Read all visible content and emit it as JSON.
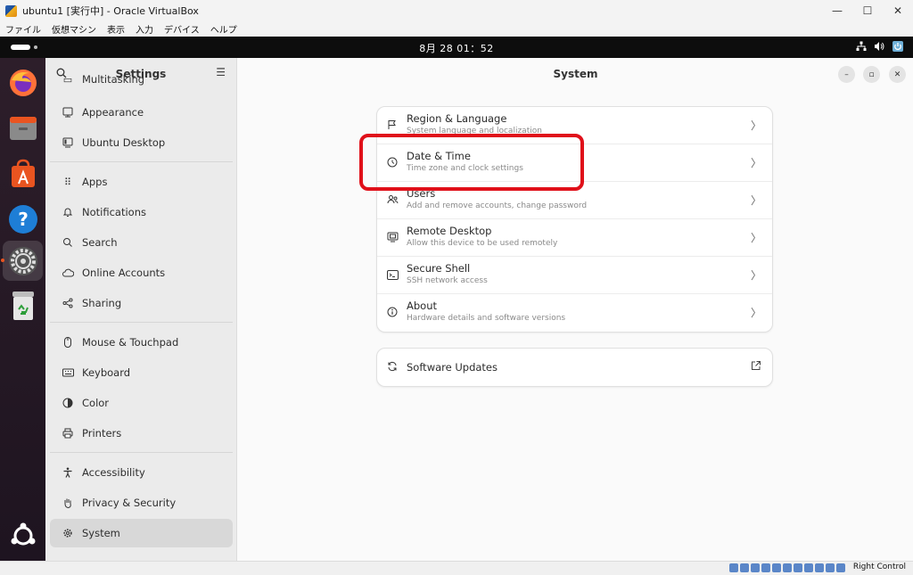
{
  "host": {
    "window_title": "ubuntu1 [実行中] - Oracle VirtualBox",
    "window_buttons": [
      "—",
      "☐",
      "✕"
    ],
    "menu": [
      "ファイル",
      "仮想マシン",
      "表示",
      "入力",
      "デバイス",
      "ヘルプ"
    ],
    "status_right": "Right Control"
  },
  "topbar": {
    "clock": "8月 28  01：52",
    "tray_icons": [
      "network-icon",
      "volume-icon",
      "power-icon"
    ]
  },
  "dock": {
    "items": [
      "firefox-icon",
      "files-icon",
      "app-center-icon",
      "help-icon",
      "settings-icon",
      "trash-icon"
    ],
    "bottom": "ubuntu-logo-icon"
  },
  "sidebar": {
    "title": "Settings",
    "items": [
      {
        "label": "Multitasking",
        "icon": "multitasking-icon"
      },
      {
        "label": "Appearance",
        "icon": "appearance-icon"
      },
      {
        "label": "Ubuntu Desktop",
        "icon": "ubuntu-desktop-icon"
      },
      {
        "label": "Apps",
        "icon": "apps-icon"
      },
      {
        "label": "Notifications",
        "icon": "bell-icon"
      },
      {
        "label": "Search",
        "icon": "search-icon"
      },
      {
        "label": "Online Accounts",
        "icon": "cloud-icon"
      },
      {
        "label": "Sharing",
        "icon": "share-icon"
      },
      {
        "label": "Mouse & Touchpad",
        "icon": "mouse-icon"
      },
      {
        "label": "Keyboard",
        "icon": "keyboard-icon"
      },
      {
        "label": "Color",
        "icon": "color-icon"
      },
      {
        "label": "Printers",
        "icon": "printer-icon"
      },
      {
        "label": "Accessibility",
        "icon": "accessibility-icon"
      },
      {
        "label": "Privacy & Security",
        "icon": "hand-icon"
      },
      {
        "label": "System",
        "icon": "gear-icon",
        "selected": true
      }
    ]
  },
  "main": {
    "title": "System",
    "rows": [
      {
        "title": "Region & Language",
        "subtitle": "System language and localization",
        "icon": "flag-icon"
      },
      {
        "title": "Date & Time",
        "subtitle": "Time zone and clock settings",
        "icon": "clock-icon"
      },
      {
        "title": "Users",
        "subtitle": "Add and remove accounts, change password",
        "icon": "users-icon"
      },
      {
        "title": "Remote Desktop",
        "subtitle": "Allow this device to be used remotely",
        "icon": "remote-desktop-icon"
      },
      {
        "title": "Secure Shell",
        "subtitle": "SSH network access",
        "icon": "terminal-icon"
      },
      {
        "title": "About",
        "subtitle": "Hardware details and software versions",
        "icon": "info-icon"
      }
    ],
    "updates": {
      "title": "Software Updates",
      "icon": "refresh-icon"
    }
  },
  "colors": {
    "highlight": "#e0101a",
    "ubuntu_orange": "#e95420"
  }
}
